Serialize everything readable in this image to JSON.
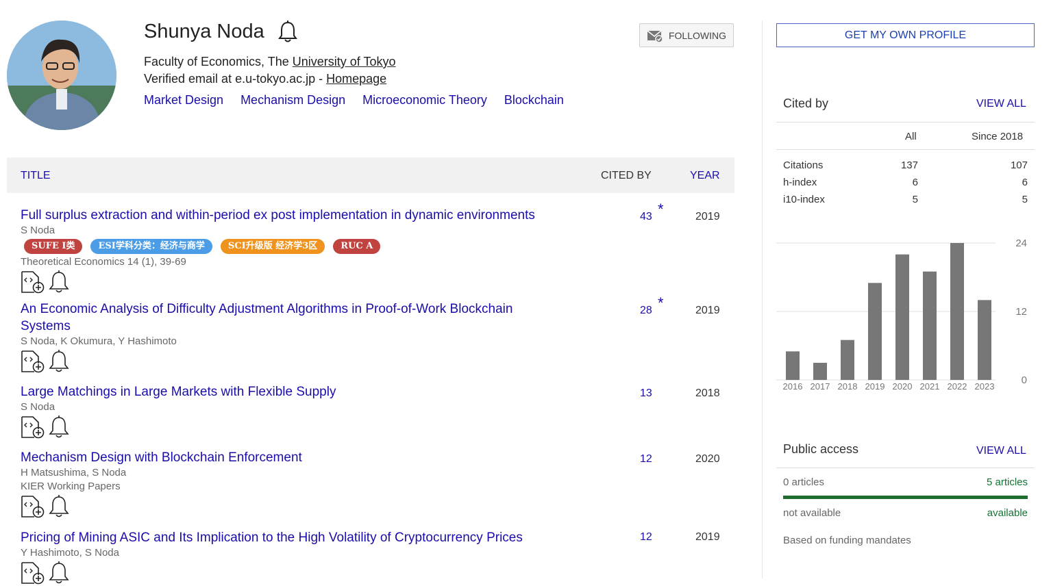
{
  "profile": {
    "name": "Shunya Noda",
    "affiliation_prefix": "Faculty of Economics, The ",
    "affiliation_link": "University of Tokyo",
    "email_text": "Verified email at e.u-tokyo.ac.jp - ",
    "homepage": "Homepage",
    "interests": [
      "Market Design",
      "Mechanism Design",
      "Microeconomic Theory",
      "Blockchain"
    ],
    "follow_label": "FOLLOWING"
  },
  "table": {
    "col_title": "TITLE",
    "col_cited": "CITED BY",
    "col_year": "YEAR"
  },
  "articles": [
    {
      "title": "Full surplus extraction and within-period ex post implementation in dynamic environments",
      "authors": "S Noda",
      "badges": [
        {
          "label": "SUFE I类",
          "color": "#c0433f"
        },
        {
          "label": "ESI学科分类：经济与商学",
          "color": "#4a9de6"
        },
        {
          "label": "SCI升级版 经济学3区",
          "color": "#f0921e"
        },
        {
          "label": "RUC A",
          "color": "#c0433f"
        }
      ],
      "venue": "Theoretical Economics 14 (1), 39-69",
      "cited": "43",
      "star": "*",
      "year": "2019"
    },
    {
      "title_line1": "An Economic Analysis of Difficulty Adjustment Algorithms in Proof-of-Work Blockchain",
      "title_line2": "Systems",
      "authors": "S Noda, K Okumura, Y Hashimoto",
      "cited": "28",
      "star": "*",
      "year": "2019"
    },
    {
      "title": "Large Matchings in Large Markets with Flexible Supply",
      "authors": "S Noda",
      "cited": "13",
      "year": "2018"
    },
    {
      "title": "Mechanism Design with Blockchain Enforcement",
      "authors": "H Matsushima, S Noda",
      "venue": "KIER Working Papers",
      "cited": "12",
      "year": "2020"
    },
    {
      "title": "Pricing of Mining ASIC and Its Implication to the High Volatility of Cryptocurrency Prices",
      "authors": "Y Hashimoto, S Noda",
      "cited": "12",
      "year": "2019"
    }
  ],
  "sidebar": {
    "get_profile": "GET MY OWN PROFILE",
    "cited_by": "Cited by",
    "view_all": "VIEW ALL",
    "col_all": "All",
    "col_since": "Since 2018",
    "stats": [
      {
        "label": "Citations",
        "all": "137",
        "since": "107"
      },
      {
        "label": "h-index",
        "all": "6",
        "since": "6"
      },
      {
        "label": "i10-index",
        "all": "5",
        "since": "5"
      }
    ],
    "public_access": "Public access",
    "pa_view_all": "VIEW ALL",
    "pa_left": "0 articles",
    "pa_right": "5 articles",
    "pa_left_sub": "not available",
    "pa_right_sub": "available",
    "pa_note": "Based on funding mandates",
    "pa_available_fraction": 1.0
  },
  "chart_data": {
    "type": "bar",
    "categories": [
      "2016",
      "2017",
      "2018",
      "2019",
      "2020",
      "2021",
      "2022",
      "2023"
    ],
    "values": [
      5,
      3,
      7,
      17,
      22,
      19,
      24,
      14
    ],
    "ylim": [
      0,
      24
    ],
    "yticks": [
      "24",
      "12",
      "0"
    ],
    "bar_color": "#777777",
    "grid": true
  }
}
